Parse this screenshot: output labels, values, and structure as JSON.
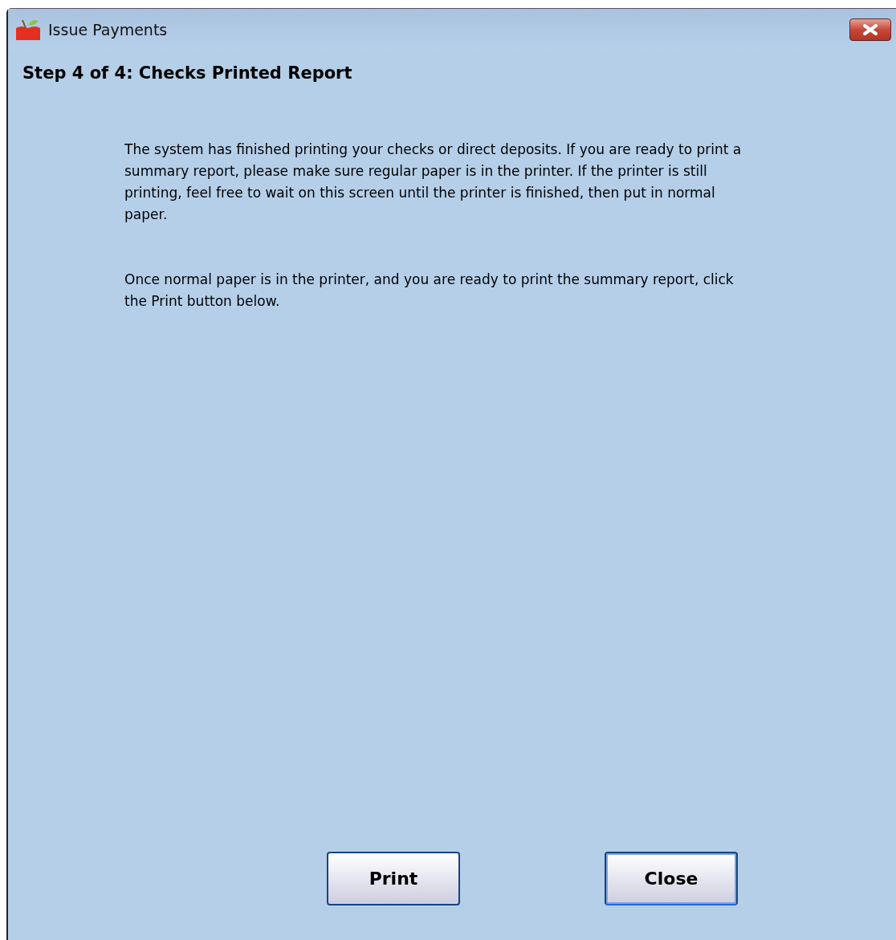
{
  "window": {
    "title": "Issue Payments"
  },
  "heading": "Step 4 of 4: Checks Printed Report",
  "paragraphs": [
    "The system has finished printing your checks or direct deposits.  If you are ready to print a summary report, please make sure regular paper is in the printer.  If the printer is still printing, feel free to wait on this screen until the printer is finished, then put in normal paper.",
    "Once normal paper is in the printer, and you are ready to print the summary report, click the Print button below."
  ],
  "buttons": [
    {
      "label": "Print",
      "focused": false
    },
    {
      "label": "Close",
      "focused": true
    }
  ]
}
